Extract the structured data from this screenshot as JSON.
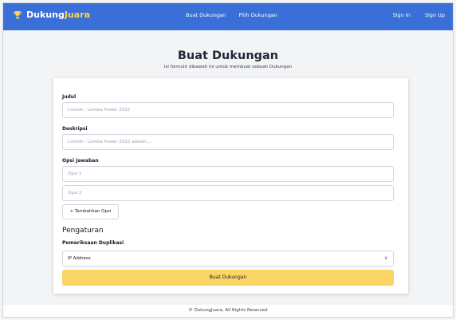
{
  "navbar": {
    "brand_prefix": "Dukung",
    "brand_accent": "Juara",
    "links_center": [
      "Buat Dukungan",
      "Pilih Dukungan"
    ],
    "links_right": [
      "Sign In",
      "Sign Up"
    ],
    "bg_color": "#3b6fd8",
    "accent_color": "#fcd34d"
  },
  "page": {
    "title": "Buat Dukungan",
    "subtitle": "Isi formulir dibawah ini untuk membuat sebuah Dukungan"
  },
  "form": {
    "judul_label": "Judul",
    "judul_placeholder": "Contoh : Lomba Poster 2022",
    "deskripsi_label": "Deskripsi",
    "deskripsi_placeholder": "Contoh : Lomba Poster 2022 adalah....",
    "opsi_label": "Opsi Jawaban",
    "opsi_placeholders": [
      "Opsi 1",
      "Opsi 2"
    ],
    "add_option_label": "+ Tambahkan Opsi",
    "settings_title": "Pengaturan",
    "duplicate_check_label": "Pemeriksaan Duplikasi",
    "duplicate_check_value": "IP Address",
    "submit_label": "Buat Dukungan",
    "submit_color": "#fcd567"
  },
  "footer": {
    "text": "© DukungJuara, All Rights Reserved"
  }
}
